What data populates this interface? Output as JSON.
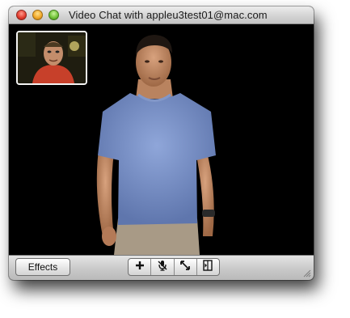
{
  "window": {
    "title": "Video Chat with appleu3test01@mac.com"
  },
  "toolbar": {
    "effects_label": "Effects",
    "controls": [
      {
        "name": "add-participant",
        "icon": "plus-icon"
      },
      {
        "name": "mute",
        "icon": "microphone-mute-icon"
      },
      {
        "name": "fullscreen",
        "icon": "expand-arrows-icon"
      },
      {
        "name": "flip",
        "icon": "flip-view-icon"
      }
    ]
  },
  "colors": {
    "video_background": "#000000",
    "close": "#e0392b",
    "minimize": "#f0a525",
    "zoom": "#6cbf34"
  }
}
